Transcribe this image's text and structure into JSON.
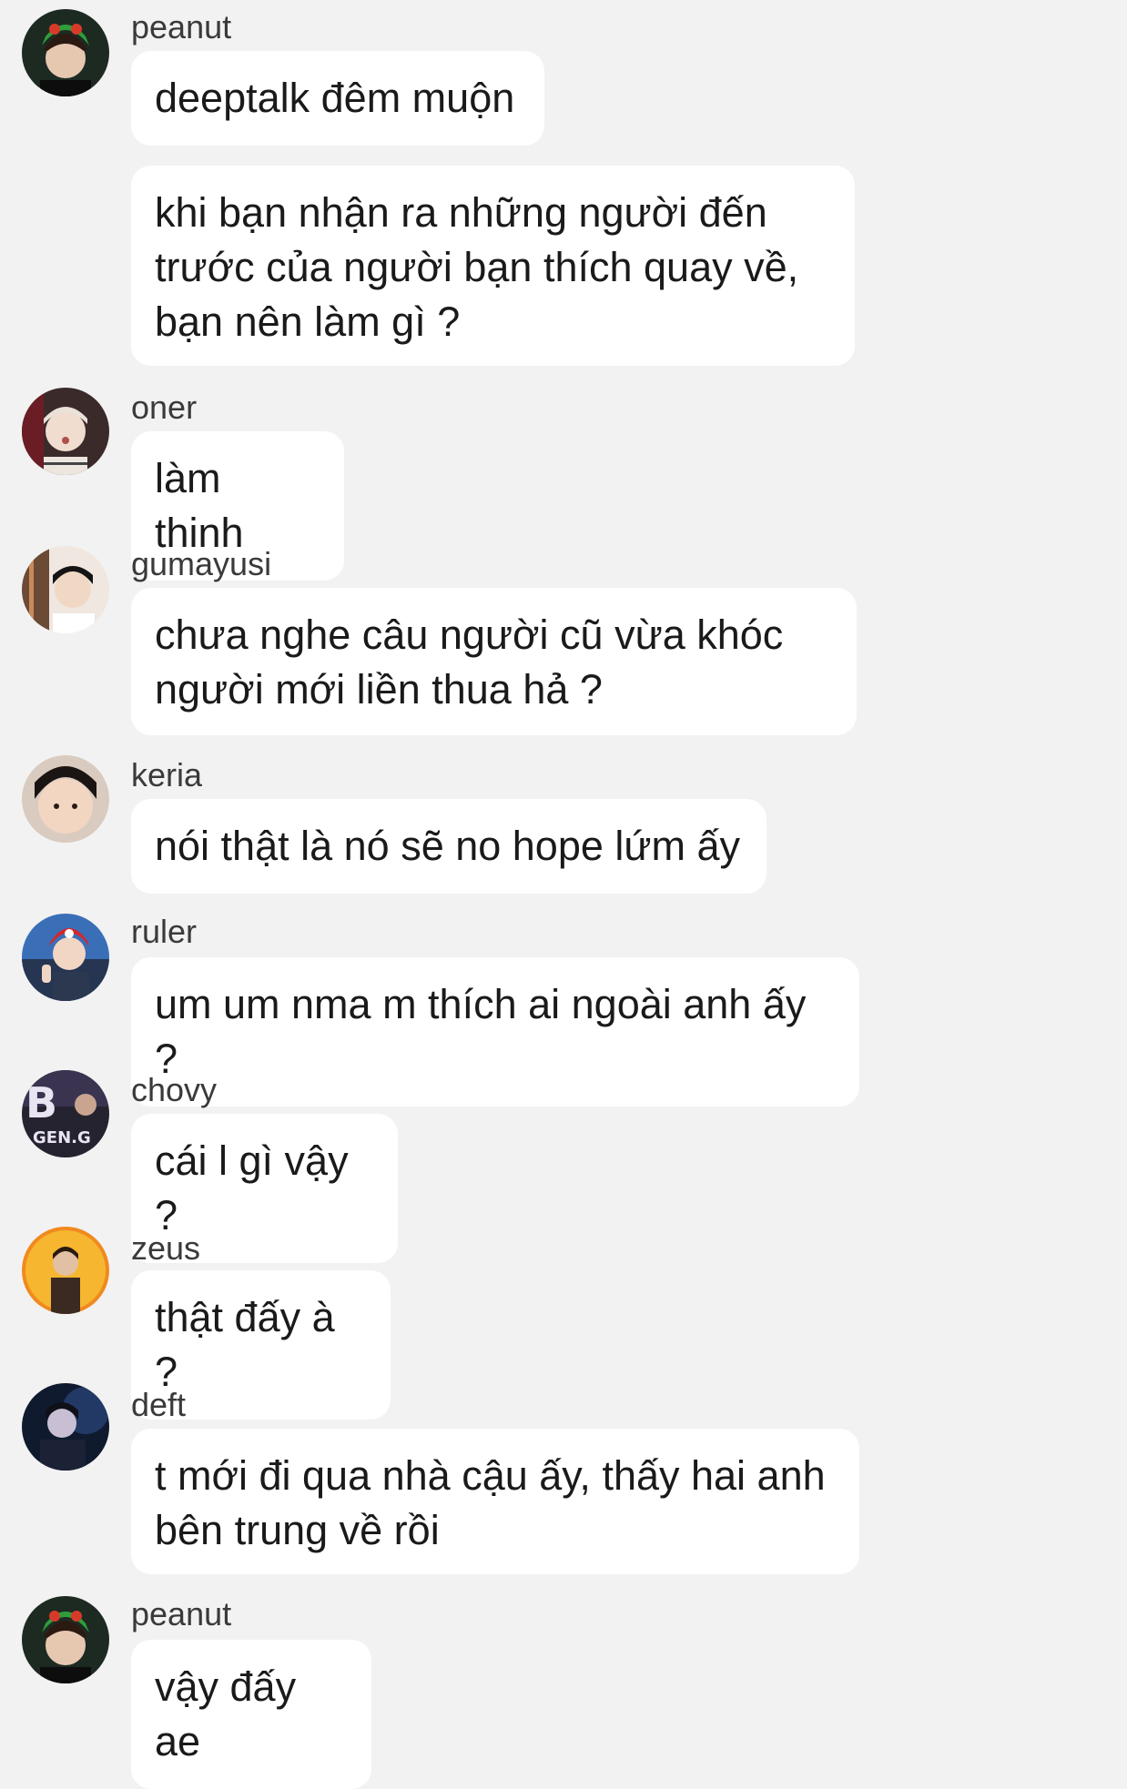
{
  "messages": [
    {
      "sender": "peanut",
      "bubbles": [
        "deeptalk đêm muộn",
        "khi bạn nhận ra những người đến trước của người bạn thích quay về, bạn nên làm gì ?"
      ]
    },
    {
      "sender": "oner",
      "bubbles": [
        "làm thinh"
      ]
    },
    {
      "sender": "gumayusi",
      "bubbles": [
        "chưa nghe câu người cũ vừa khóc người mới liền thua hả ?"
      ]
    },
    {
      "sender": "keria",
      "bubbles": [
        "nói thật là nó sẽ no hope lứm ấy"
      ]
    },
    {
      "sender": "ruler",
      "bubbles": [
        "um um nma m thích ai ngoài anh ấy ?"
      ]
    },
    {
      "sender": "chovy",
      "bubbles": [
        "cái l gì vậy ?"
      ]
    },
    {
      "sender": "zeus",
      "bubbles": [
        "thật đấy à ?"
      ]
    },
    {
      "sender": "deft",
      "bubbles": [
        "t mới đi qua nhà cậu ấy, thấy hai anh bên trung về rồi"
      ]
    },
    {
      "sender": "peanut",
      "bubbles": [
        "vậy đấy ae"
      ]
    }
  ],
  "avatar_logo_text": "GEN.G",
  "colors": {
    "background": "#f2f2f2",
    "bubble": "#ffffff",
    "text": "#1a1a1a",
    "sender": "#3a3a3a"
  }
}
